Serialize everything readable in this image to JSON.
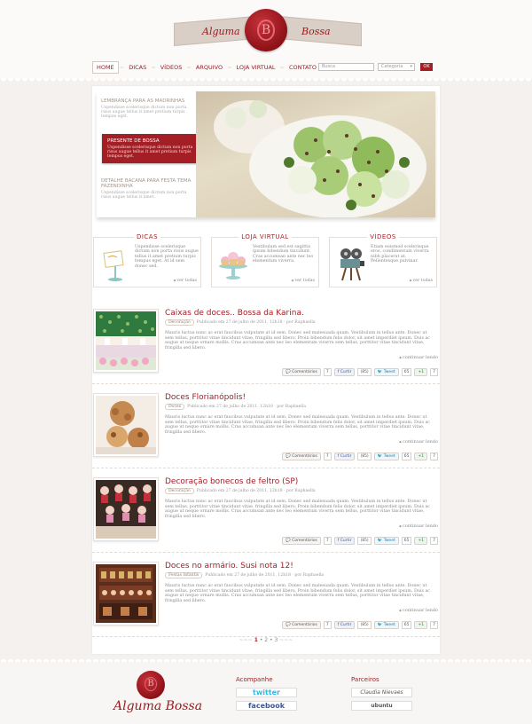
{
  "brand": {
    "left": "Alguma",
    "right": "Bossa",
    "footer": "Alguma Bossa"
  },
  "nav": {
    "items": [
      {
        "label": "Home",
        "active": true
      },
      {
        "label": "Dicas"
      },
      {
        "label": "Vídeos"
      },
      {
        "label": "Arquivo"
      },
      {
        "label": "Loja Virtual"
      },
      {
        "label": "Contato"
      }
    ]
  },
  "search": {
    "placeholder": "Busca"
  },
  "category": {
    "label": "Categoria"
  },
  "ok_label": "OK",
  "slider": {
    "items": [
      {
        "title": "Lembrança para as madrinhas",
        "desc": "Uspendisse scelerisque dictum non porta risus augue tellus it amet pretium turpis tempus eget."
      },
      {
        "title": "Presente de Bossa",
        "desc": "Uspendisse scelerisque dictum non porta risus augue tellus it amet pretium turpis tempus eget."
      },
      {
        "title": "Detalhe bacana para festa tema Fazendinha",
        "desc": "Uspendisse scelerisque dictum non porta risus augue tellus it amet."
      }
    ]
  },
  "features": [
    {
      "title": "DICAS",
      "desc": "Uspendisse scelerisque dictum non porta risus augue tellus it amet pretium turpis tempus eget. At id sem donec sed.",
      "more": "ver todas"
    },
    {
      "title": "LOJA VIRTUAL",
      "desc": "Vestibulum sed est sagittis ipsum bibendum tincidunt. Cras accumsan ante nec leo elementum viverra.",
      "more": "ver todas"
    },
    {
      "title": "VÍDEOS",
      "desc": "Etiam euismod scelerisque eros, condimentum viverra nibh placerat at. Pellentesque pulvinar.",
      "more": "ver todas"
    }
  ],
  "post_common": {
    "body": "Mauris luctus nunc ac erat faucibus vulputate at id sem. Donec sed malesuada quam. Vestibulum in tellus ante. Donec ut sem tellus, porttitor vitae tincidunt vitae, fringilla sed libero. Proin bibendum felis dolor, sit amet imperdiet ipsum. Duis ac augue ut neque ornare mollis. Cras accumsan ante nec leo elementum viverra sem tellus, porttitor vitae tincidunt vitae, fringilla sed libero.",
    "continue": "continuar lendo",
    "comments": "Comentários",
    "comments_count": "7",
    "fb": "Curtir",
    "fb_count": "(85)",
    "tweet": "Tweet",
    "tw_count": "65",
    "plus": "+1",
    "plus_count": "7"
  },
  "posts": [
    {
      "title": "Caixas de doces.. Bossa da Karina.",
      "tag": "Decoração",
      "meta": "Publicado em 27 de julho de 2011, 12h18 · por Raphaella"
    },
    {
      "title": "Doces Florianópolis!",
      "tag": "Doces",
      "meta": "Publicado em 27 de julho de 2011, 12h18 · por Raphaella"
    },
    {
      "title": "Decoração bonecos de feltro (SP)",
      "tag": "Decoração",
      "meta": "Publicado em 27 de julho de 2011, 12h18 · por Raphaella"
    },
    {
      "title": "Doces no armário. Susi nota 12!",
      "tag": "Festas Infantis",
      "meta": "Publicado em 27 de julho de 2011, 12h18 · por Raphaella"
    }
  ],
  "pager": {
    "p1": "1",
    "p2": "2",
    "p3": "3"
  },
  "footer": {
    "follow": "Acompanhe",
    "twitter": "twitter",
    "facebook": "facebook",
    "partners": "Parceiros",
    "partner1": "Claudia Nievaes",
    "partner2": "ubuntu"
  }
}
